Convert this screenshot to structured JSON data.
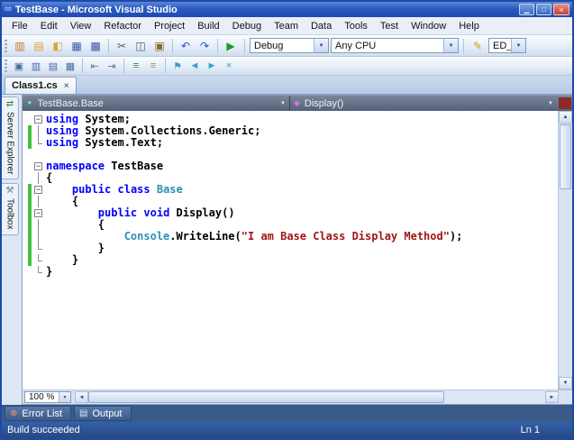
{
  "window": {
    "title": "TestBase - Microsoft Visual Studio",
    "logo_glyph": "∞",
    "minimize_glyph": "▁",
    "maximize_glyph": "□",
    "close_glyph": "×"
  },
  "menu": {
    "items": [
      "File",
      "Edit",
      "View",
      "Refactor",
      "Project",
      "Build",
      "Debug",
      "Team",
      "Data",
      "Tools",
      "Test",
      "Window",
      "Help"
    ]
  },
  "icons": {
    "dropdown": "▼",
    "up": "▲",
    "down": "▼",
    "left": "◄",
    "right": "►",
    "tab_close": "×",
    "collapse": "−"
  },
  "toolbar1": {
    "groups": [
      [
        [
          "new-project-icon",
          "▥",
          "#c87a20"
        ],
        [
          "add-item-icon",
          "▤",
          "#e0a030"
        ],
        [
          "open-file-icon",
          "◧",
          "#d8a838"
        ],
        [
          "save-icon",
          "▦",
          "#3858a0"
        ],
        [
          "save-all-icon",
          "▩",
          "#3858a0"
        ]
      ],
      [
        [
          "cut-icon",
          "✂",
          "#50606e"
        ],
        [
          "copy-icon",
          "◫",
          "#50606e"
        ],
        [
          "paste-icon",
          "▣",
          "#8a6a30"
        ]
      ],
      [
        [
          "undo-icon",
          "↶",
          "#2858c8"
        ],
        [
          "redo-icon",
          "↷",
          "#2858c8"
        ]
      ],
      [
        [
          "start-debug-icon",
          "▶",
          "#1a9a1a"
        ]
      ]
    ],
    "debug_combo": "Debug",
    "platform_combo": "Any CPU",
    "find_icon_glyph": "✎",
    "find_combo": "ED_"
  },
  "toolbar2": {
    "groups": [
      [
        [
          "member-list-icon",
          "▣",
          "#4a6aa0"
        ],
        [
          "parameter-info-icon",
          "▥",
          "#4a6aa0"
        ],
        [
          "quick-info-icon",
          "▤",
          "#4a6aa0"
        ],
        [
          "word-completion-icon",
          "▦",
          "#4a6aa0"
        ]
      ],
      [
        [
          "decrease-indent-icon",
          "⇤",
          "#5878b0"
        ],
        [
          "increase-indent-icon",
          "⇥",
          "#5878b0"
        ]
      ],
      [
        [
          "comment-icon",
          "≡",
          "#3a8a3a"
        ],
        [
          "uncomment-icon",
          "≡",
          "#9a9a4a"
        ]
      ],
      [
        [
          "toggle-bookmark-icon",
          "⚑",
          "#38a0c8"
        ],
        [
          "prev-bookmark-icon",
          "◄",
          "#38a0c8"
        ],
        [
          "next-bookmark-icon",
          "►",
          "#38a0c8"
        ],
        [
          "clear-bookmarks-icon",
          "×",
          "#38a0c8"
        ]
      ]
    ]
  },
  "tabs": [
    {
      "label": "Class1.cs"
    }
  ],
  "navbar": {
    "left_icon_glyph": "✦",
    "left_combo": "TestBase.Base",
    "right_icon_glyph": "◆",
    "right_combo": "Display()"
  },
  "sidebar": {
    "items": [
      {
        "label": "Server Explorer",
        "glyph": "⇄",
        "color": "#3a7a3a"
      },
      {
        "label": "Toolbox",
        "glyph": "⚒",
        "color": "#707880"
      }
    ]
  },
  "editor": {
    "lines": [
      {
        "f": "m",
        "c": false,
        "segs": [
          [
            "k",
            "using"
          ],
          [
            "p",
            " System;"
          ]
        ]
      },
      {
        "f": "v",
        "c": true,
        "segs": [
          [
            "k",
            "using"
          ],
          [
            "p",
            " System.Collections.Generic;"
          ]
        ]
      },
      {
        "f": "e",
        "c": true,
        "segs": [
          [
            "k",
            "using"
          ],
          [
            "p",
            " System.Text;"
          ]
        ]
      },
      {
        "f": "",
        "c": false,
        "segs": []
      },
      {
        "f": "m",
        "c": false,
        "segs": [
          [
            "k",
            "namespace"
          ],
          [
            "p",
            " TestBase"
          ]
        ]
      },
      {
        "f": "v",
        "c": false,
        "segs": [
          [
            "p",
            "{"
          ]
        ]
      },
      {
        "f": "m",
        "c": true,
        "segs": [
          [
            "p",
            "    "
          ],
          [
            "k",
            "public"
          ],
          [
            "p",
            " "
          ],
          [
            "k",
            "class"
          ],
          [
            "p",
            " "
          ],
          [
            "t",
            "Base"
          ]
        ]
      },
      {
        "f": "v",
        "c": true,
        "segs": [
          [
            "p",
            "    {"
          ]
        ]
      },
      {
        "f": "m",
        "c": true,
        "segs": [
          [
            "p",
            "        "
          ],
          [
            "k",
            "public"
          ],
          [
            "p",
            " "
          ],
          [
            "k",
            "void"
          ],
          [
            "p",
            " Display()"
          ]
        ]
      },
      {
        "f": "v",
        "c": true,
        "segs": [
          [
            "p",
            "        {"
          ]
        ]
      },
      {
        "f": "v",
        "c": true,
        "segs": [
          [
            "p",
            "            "
          ],
          [
            "t",
            "Console"
          ],
          [
            "p",
            ".WriteLine("
          ],
          [
            "s",
            "\"I am Base Class Display Method\""
          ],
          [
            "p",
            ");"
          ]
        ]
      },
      {
        "f": "e",
        "c": true,
        "segs": [
          [
            "p",
            "        }"
          ]
        ]
      },
      {
        "f": "e",
        "c": true,
        "segs": [
          [
            "p",
            "    }"
          ]
        ]
      },
      {
        "f": "e",
        "c": false,
        "segs": [
          [
            "p",
            "}"
          ]
        ]
      }
    ]
  },
  "zoom": {
    "value": "100 %"
  },
  "bottom_panel": {
    "tabs": [
      {
        "label": "Error List",
        "glyph": "⊗",
        "color": "#ff8a70"
      },
      {
        "label": "Output",
        "glyph": "▤",
        "color": "#cfe0f4"
      }
    ]
  },
  "status": {
    "message": "Build succeeded",
    "line_indicator": "Ln 1"
  },
  "colors": {
    "keyword": "#0000ff",
    "type_name": "#2b91af",
    "string_literal": "#a31515",
    "plain_text": "#000000",
    "change_bar": "#40c040",
    "status_bar": "#3360ac"
  }
}
